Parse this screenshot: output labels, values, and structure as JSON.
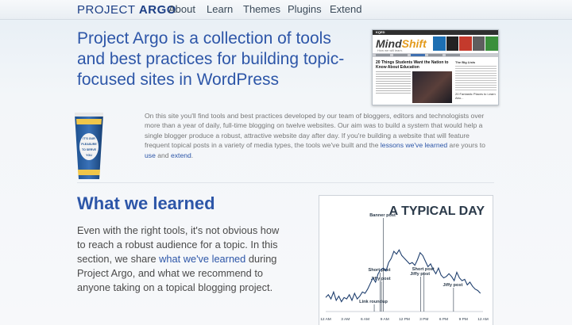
{
  "nav": {
    "brand_light": "PROJECT ",
    "brand_bold": "ARGO",
    "links": [
      "About",
      "Learn",
      "Themes",
      "Plugins",
      "Extend"
    ]
  },
  "hero": {
    "title": "Project Argo is a collection of tools and best practices for building topic-focused sites in WordPress",
    "screenshot": {
      "network": "KQED",
      "logo_a": "Mind",
      "logo_b": "Shift",
      "tagline": "How we will learn.",
      "headline": "20 Things Students Want the Nation to Know About Education",
      "sidebar_title": "The Big Lists",
      "sidebar_bottom": "20 Fantastic Places to Learn Abo..."
    }
  },
  "intro": {
    "text_1": "On this site you'll find tools and best practices developed by our team of bloggers, editors and technologists over more than a year of daily, full-time blogging on twelve websites. Our aim was to build a system that would help a single blogger produce a robust, attractive website day after day. If you're building a website that will feature frequent topical posts in a variety of media types, the tools we've built and the ",
    "link_lessons": "lessons we've learned",
    "text_2": " are yours to ",
    "link_use": "use",
    "text_3": " and ",
    "link_extend": "extend",
    "text_4": ".",
    "cup_text": [
      "IT'S OUR",
      "PLEASURE",
      "TO SERVE",
      "YOU"
    ]
  },
  "learned": {
    "title": "What we learned",
    "text_1": "Even with the right tools, it's not obvious how to reach a robust audience for a topic. In this section, we share ",
    "link": "what we've learned",
    "text_2": " during Project Argo, and what we recommend to anyone taking on a topical blogging project."
  },
  "chart_data": {
    "type": "line",
    "title": "A TYPICAL DAY",
    "x_ticks": [
      "12 AM",
      "3 AM",
      "6 AM",
      "9 AM",
      "12 PM",
      "3 PM",
      "6 PM",
      "9 PM",
      "12 AM"
    ],
    "x_range": [
      0,
      24
    ],
    "annotations": [
      {
        "label": "Banner post",
        "x": 8.8
      },
      {
        "label": "Link roundup",
        "x": 7.4
      },
      {
        "label": "Jiffy post",
        "x": 8.5
      },
      {
        "label": "Short post",
        "x": 8.3
      },
      {
        "label": "Jiffy post",
        "x": 14.5
      },
      {
        "label": "Short post",
        "x": 15.0
      },
      {
        "label": "Jiffy post",
        "x": 19.5
      }
    ],
    "series": [
      {
        "x": [
          0,
          0.4,
          0.8,
          1.2,
          1.6,
          2,
          2.4,
          2.8,
          3.2,
          3.6,
          4,
          4.4,
          4.8,
          5.2,
          5.6,
          6,
          6.4,
          6.8,
          7.2,
          7.6,
          8,
          8.4,
          8.8,
          9.2,
          9.6,
          10,
          10.4,
          10.8,
          11.2,
          11.6,
          12,
          12.4,
          12.8,
          13.2,
          13.6,
          14,
          14.4,
          14.8,
          15.2,
          15.6,
          16,
          16.4,
          16.8,
          17.2,
          17.6,
          18,
          18.4,
          18.8,
          19.2,
          19.6,
          20,
          20.4,
          20.8,
          21.2,
          21.6,
          22,
          22.4,
          22.8,
          23.2,
          23.6
        ],
        "y": [
          10,
          12,
          9,
          14,
          8,
          11,
          7,
          10,
          9,
          12,
          8,
          13,
          9,
          11,
          14,
          13,
          16,
          20,
          24,
          21,
          27,
          30,
          31,
          29,
          35,
          38,
          43,
          41,
          44,
          40,
          38,
          36,
          34,
          35,
          33,
          37,
          42,
          40,
          36,
          32,
          34,
          30,
          27,
          31,
          26,
          24,
          25,
          27,
          25,
          22,
          28,
          24,
          22,
          23,
          19,
          21,
          18,
          16,
          15,
          13
        ]
      }
    ]
  }
}
